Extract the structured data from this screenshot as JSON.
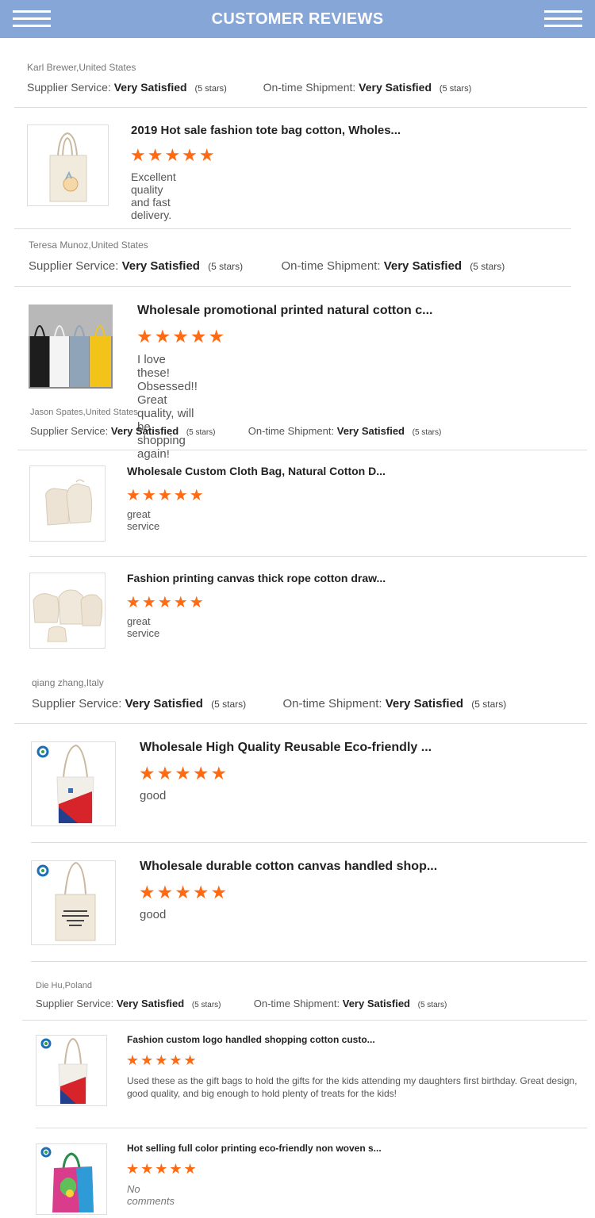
{
  "header": {
    "title": "CUSTOMER REVIEWS"
  },
  "labels": {
    "supplier_service": "Supplier Service:",
    "ontime_shipment": "On-time Shipment:"
  },
  "star_glyphs": "★★★★★",
  "reviews": [
    {
      "reviewer": "Karl Brewer,United States",
      "supplier_rating": "Very Satisfied",
      "supplier_stars": "(5 stars)",
      "shipment_rating": "Very Satisfied",
      "shipment_stars": "(5 stars)",
      "products": [
        {
          "title": "2019 Hot sale fashion tote bag cotton, Wholes...",
          "stars": 5,
          "comment": "Excellent quality and fast delivery."
        }
      ]
    },
    {
      "reviewer": "Teresa Munoz,United States",
      "supplier_rating": "Very Satisfied",
      "supplier_stars": "(5 stars)",
      "shipment_rating": "Very Satisfied",
      "shipment_stars": "(5 stars)",
      "products": [
        {
          "title": "Wholesale promotional printed natural cotton c...",
          "stars": 5,
          "comment": "I love these! Obsessed!! Great quality, will be shopping again!"
        }
      ]
    },
    {
      "reviewer": "Jason Spates,United States",
      "supplier_rating": "Very Satisfied",
      "supplier_stars": "(5 stars)",
      "shipment_rating": "Very Satisfied",
      "shipment_stars": "(5 stars)",
      "products": [
        {
          "title": "Wholesale Custom Cloth Bag, Natural Cotton D...",
          "stars": 5,
          "comment": "great service"
        },
        {
          "title": "Fashion printing canvas thick rope cotton draw...",
          "stars": 5,
          "comment": "great service"
        }
      ]
    },
    {
      "reviewer": "qiang zhang,Italy",
      "supplier_rating": "Very Satisfied",
      "supplier_stars": "(5 stars)",
      "shipment_rating": "Very Satisfied",
      "shipment_stars": "(5 stars)",
      "products": [
        {
          "title": "Wholesale High Quality Reusable Eco-friendly ...",
          "stars": 5,
          "comment": "good"
        },
        {
          "title": "Wholesale durable cotton canvas handled shop...",
          "stars": 5,
          "comment": "good"
        }
      ]
    },
    {
      "reviewer": "Die Hu,Poland",
      "supplier_rating": "Very Satisfied",
      "supplier_stars": "(5 stars)",
      "shipment_rating": "Very Satisfied",
      "shipment_stars": "(5 stars)",
      "products": [
        {
          "title": "Fashion custom logo handled shopping cotton custo...",
          "stars": 5,
          "comment": "Used these as the gift bags to hold the gifts for the kids attending my daughters first birthday. Great design, good quality, and big enough to hold plenty of treats for the kids!"
        },
        {
          "title": "Hot selling full color printing eco-friendly non woven s...",
          "stars": 5,
          "comment": "No comments"
        }
      ]
    }
  ]
}
